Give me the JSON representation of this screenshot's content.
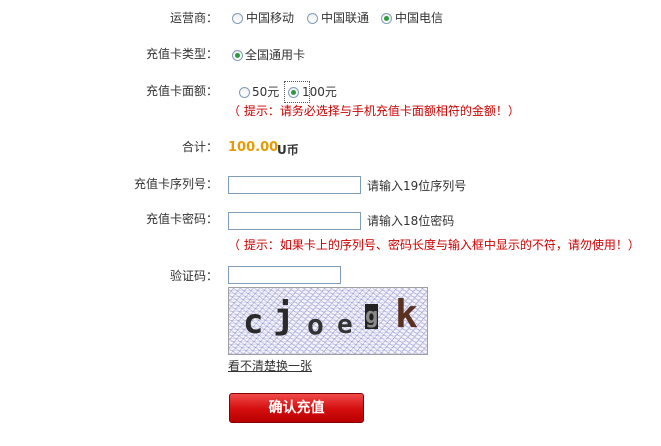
{
  "operator": {
    "label": "运营商：",
    "options": [
      "中国移动",
      "中国联通",
      "中国电信"
    ],
    "selected": "中国电信"
  },
  "card_type": {
    "label": "充值卡类型：",
    "options": [
      "全国通用卡"
    ],
    "selected": "全国通用卡"
  },
  "denomination": {
    "label": "充值卡面额：",
    "options": [
      "50元",
      "100元"
    ],
    "selected": "100元",
    "hint": "（ 提示：请务必选择与手机充值卡面额相符的金额！）"
  },
  "total": {
    "label": "合计：",
    "amount": "100.00",
    "unit": "U币",
    "amount_color": "#e89a00"
  },
  "serial": {
    "label": "充值卡序列号：",
    "value": "",
    "help": "请输入19位序列号"
  },
  "password": {
    "label": "充值卡密码：",
    "value": "",
    "help": "请输入18位密码",
    "hint": "（ 提示：如果卡上的序列号、密码长度与输入框中显示的不符，请勿使用！）"
  },
  "captcha": {
    "label": "验证码：",
    "value": "",
    "image_text": "cjoegk",
    "refresh_link": "看不清楚换一张"
  },
  "submit": {
    "label": "确认充值",
    "color": "#d40d0d"
  }
}
